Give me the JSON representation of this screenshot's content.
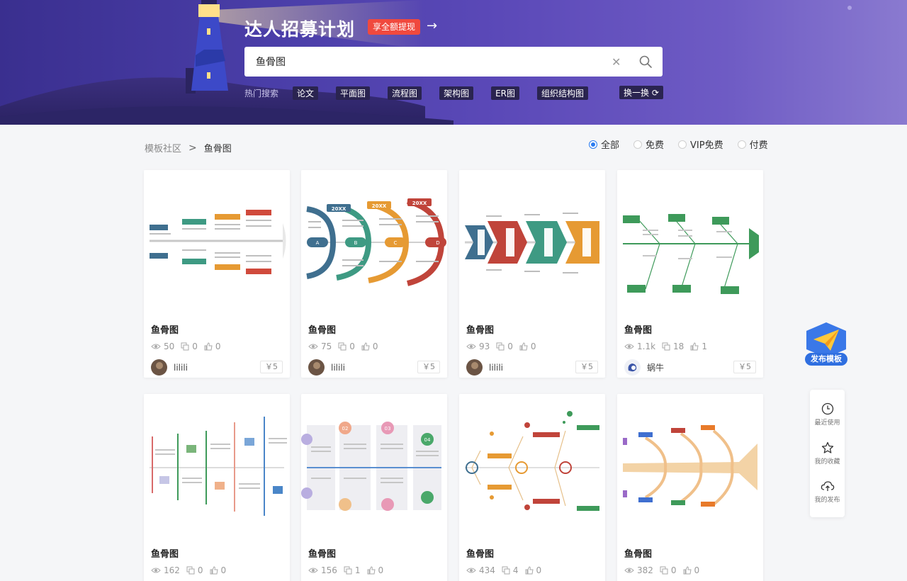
{
  "hero": {
    "title": "达人招募计划",
    "badge": "享全额提现",
    "arrow": "→",
    "search_value": "鱼骨图",
    "hot_label": "热门搜索",
    "hot_tags": [
      "论文",
      "平面图",
      "流程图",
      "架构图",
      "ER图",
      "组织结构图"
    ],
    "swap_label": "换一换"
  },
  "breadcrumb": {
    "root": "模板社区",
    "separator": ">",
    "current": "鱼骨图"
  },
  "filters": {
    "options": [
      "全部",
      "免费",
      "VIP免费",
      "付费"
    ],
    "selected": "全部"
  },
  "cards": [
    {
      "title": "鱼骨图",
      "views": "50",
      "copies": "0",
      "likes": "0",
      "author": "lilili",
      "price": "￥5"
    },
    {
      "title": "鱼骨图",
      "views": "75",
      "copies": "0",
      "likes": "0",
      "author": "lilili",
      "price": "￥5"
    },
    {
      "title": "鱼骨图",
      "views": "93",
      "copies": "0",
      "likes": "0",
      "author": "lilili",
      "price": "￥5"
    },
    {
      "title": "鱼骨图",
      "views": "1.1k",
      "copies": "18",
      "likes": "1",
      "author": "蜗牛",
      "price": "￥5"
    },
    {
      "title": "鱼骨图",
      "views": "162",
      "copies": "0",
      "likes": "0"
    },
    {
      "title": "鱼骨图",
      "views": "156",
      "copies": "1",
      "likes": "0"
    },
    {
      "title": "鱼骨图",
      "views": "434",
      "copies": "4",
      "likes": "0"
    },
    {
      "title": "鱼骨图",
      "views": "382",
      "copies": "0",
      "likes": "0"
    }
  ],
  "thumbs": {
    "card2_labels": [
      "20XX",
      "20XX",
      "20XX",
      "A",
      "B",
      "C",
      "D"
    ],
    "card6_labels": [
      "02",
      "03",
      "04"
    ]
  },
  "publish_label": "发布模板",
  "side": {
    "recent": "最近使用",
    "favorites": "我的收藏",
    "mine": "我的发布"
  },
  "colors": {
    "accent": "#2a7cf0",
    "badge": "#f0493e",
    "hero_dark": "#2a2450"
  }
}
